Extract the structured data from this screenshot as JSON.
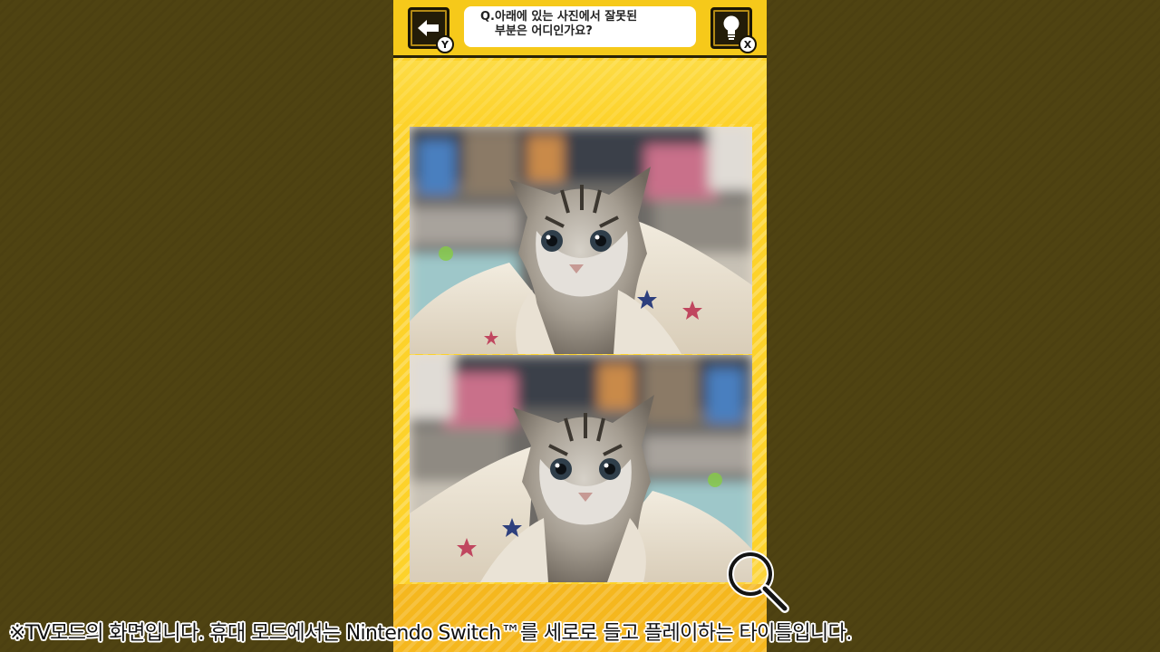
{
  "header": {
    "back_key": "Y",
    "hint_key": "X",
    "question_line1": "Q.아래에 있는 사진에서 잘못된",
    "question_line2": "부분은 어디인가요?"
  },
  "puzzle": {
    "top_image": "kitten-under-star-blanket",
    "bottom_image": "kitten-under-star-blanket-mirrored"
  },
  "footer": {
    "caption": "※TV모드의 화면입니다. 휴대 모드에서는 Nintendo Switch™를 세로로 들고 플레이하는 타이틀입니다."
  },
  "icons": [
    "arrow-left-icon",
    "lightbulb-icon",
    "magnifier-icon"
  ],
  "colors": {
    "background": "#4f4312",
    "phone_yellow": "#fdd22a",
    "button_dark": "#231c08"
  }
}
